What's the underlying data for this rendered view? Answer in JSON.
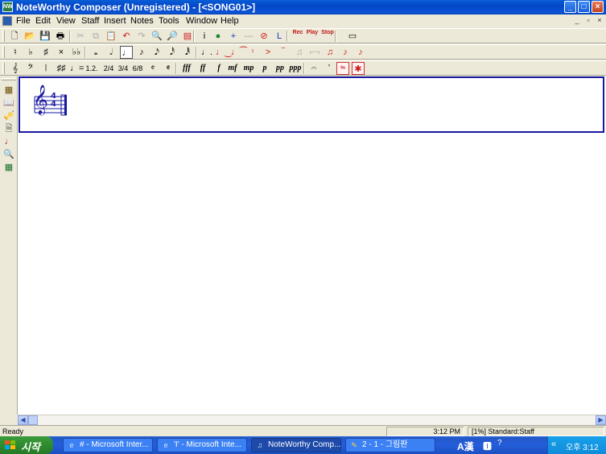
{
  "window": {
    "title": "NoteWorthy Composer (Unregistered) - [<SONG01>]",
    "icon": "noteworthy-app-icon",
    "app_icon_text": "NW",
    "controls": {
      "minimize": "_",
      "maximize": "□",
      "close": "×"
    }
  },
  "menubar": {
    "items": [
      "File",
      "Edit",
      "View",
      "Staff",
      "Insert",
      "Notes",
      "Tools",
      "Window",
      "Help"
    ],
    "mdi": {
      "minimize": "_",
      "restore": "▫",
      "close": "×"
    }
  },
  "toolbar_main": [
    {
      "icon": "new-file-icon",
      "glyph": "🗋"
    },
    {
      "icon": "open-folder-icon",
      "glyph": "📂"
    },
    {
      "icon": "save-icon",
      "glyph": "💾"
    },
    {
      "icon": "print-icon",
      "glyph": "🖶"
    },
    {
      "icon": "cut-icon",
      "glyph": "✂"
    },
    {
      "icon": "copy-icon",
      "glyph": "⧉"
    },
    {
      "icon": "paste-icon",
      "glyph": "📋"
    },
    {
      "icon": "undo-icon",
      "glyph": "↶"
    },
    {
      "icon": "redo-icon",
      "glyph": "↷"
    },
    {
      "icon": "zoom-in-icon",
      "glyph": "🔍"
    },
    {
      "icon": "zoom-out-icon",
      "glyph": "🔎"
    },
    {
      "icon": "staff-properties-icon",
      "glyph": "▤"
    },
    {
      "icon": "info-icon",
      "glyph": "i"
    },
    {
      "icon": "globe-icon",
      "glyph": "●"
    },
    {
      "icon": "add-staff-icon",
      "glyph": "+"
    },
    {
      "icon": "delete-staff-icon",
      "glyph": "—"
    },
    {
      "icon": "mute-icon",
      "glyph": "⊘"
    },
    {
      "icon": "lyrics-icon",
      "glyph": "L"
    },
    {
      "icon": "record-icon",
      "label": "Rec"
    },
    {
      "icon": "play-icon",
      "label": "Play"
    },
    {
      "icon": "stop-icon",
      "label": "Stop"
    },
    {
      "icon": "piano-keyboard-icon",
      "glyph": "▭"
    }
  ],
  "toolbar_notes": [
    {
      "icon": "natural-icon",
      "glyph": "♮"
    },
    {
      "icon": "flat-icon",
      "glyph": "♭"
    },
    {
      "icon": "sharp-icon",
      "glyph": "♯"
    },
    {
      "icon": "double-sharp-icon",
      "glyph": "×"
    },
    {
      "icon": "double-flat-icon",
      "glyph": "♭♭"
    },
    {
      "icon": "whole-note-icon",
      "glyph": "𝅝"
    },
    {
      "icon": "half-note-icon",
      "glyph": "𝅗𝅥"
    },
    {
      "icon": "quarter-note-icon",
      "glyph": "♩"
    },
    {
      "icon": "eighth-note-icon",
      "glyph": "♪"
    },
    {
      "icon": "sixteenth-note-icon",
      "glyph": "𝅘𝅥𝅯"
    },
    {
      "icon": "thirtysecond-note-icon",
      "glyph": "𝅘𝅥𝅰"
    },
    {
      "icon": "sixtyfourth-note-icon",
      "glyph": "𝅘𝅥𝅱"
    },
    {
      "icon": "dotted-note-icon",
      "glyph": "♩."
    },
    {
      "icon": "slur-icon",
      "glyph": "♩‿"
    },
    {
      "icon": "tie-icon",
      "glyph": "♩⁀"
    },
    {
      "icon": "staccato-icon",
      "glyph": "ᶦ"
    },
    {
      "icon": "accent-icon",
      "glyph": ">"
    },
    {
      "icon": "tenuto-icon",
      "glyph": "‾"
    },
    {
      "icon": "grace-note-icon",
      "glyph": "♫"
    },
    {
      "icon": "triplet-icon",
      "glyph": "⌐¬"
    },
    {
      "icon": "beam-icon",
      "glyph": "♫"
    },
    {
      "icon": "stem-up-icon",
      "glyph": "♪"
    },
    {
      "icon": "stem-down-icon",
      "glyph": "♪"
    }
  ],
  "toolbar_symbols": [
    {
      "icon": "treble-clef-icon",
      "glyph": "𝄞"
    },
    {
      "icon": "bass-clef-icon",
      "glyph": "𝄢"
    },
    {
      "icon": "double-barline-icon",
      "glyph": "𝄁"
    },
    {
      "icon": "key-signature-icon",
      "glyph": "♯♯"
    },
    {
      "icon": "tempo-icon",
      "glyph": "♩="
    },
    {
      "icon": "ending-icon",
      "glyph": "1.2."
    },
    {
      "icon": "time-sig-2-4-icon",
      "glyph": "2/4"
    },
    {
      "icon": "time-sig-3-4-icon",
      "glyph": "3/4"
    },
    {
      "icon": "time-sig-6-8-icon",
      "glyph": "6/8"
    },
    {
      "icon": "common-time-icon",
      "glyph": "𝄴"
    },
    {
      "icon": "cut-time-icon",
      "glyph": "𝄵"
    }
  ],
  "dynamics": [
    "fff",
    "ff",
    "f",
    "mf",
    "mp",
    "p",
    "pp",
    "ppp"
  ],
  "toolbar_extra": [
    {
      "icon": "fermata-icon",
      "glyph": "𝄐"
    },
    {
      "icon": "breath-mark-icon",
      "glyph": "ʼ"
    },
    {
      "icon": "pedal-down-icon",
      "glyph": "𝆮"
    },
    {
      "icon": "pedal-up-icon",
      "glyph": "✱"
    }
  ],
  "left_tools": [
    {
      "icon": "staff-view-icon",
      "glyph": "▦"
    },
    {
      "icon": "book-icon",
      "glyph": "📖"
    },
    {
      "icon": "instrument-icon",
      "glyph": "🎺"
    },
    {
      "icon": "page-setup-icon",
      "glyph": "🗎"
    },
    {
      "icon": "note-entry-icon",
      "glyph": "♩"
    },
    {
      "icon": "find-icon",
      "glyph": "🔍"
    },
    {
      "icon": "grid-icon",
      "glyph": "▦"
    }
  ],
  "staff": {
    "clef": "treble",
    "time_signature": "4/4"
  },
  "statusbar": {
    "text": "Ready",
    "time": "3:12 PM",
    "staff_info": "[1%] Standard:Staff"
  },
  "taskbar": {
    "start_label": "시작",
    "buttons": [
      {
        "label": "# - Microsoft Inter...",
        "icon": "ie-icon",
        "active": false
      },
      {
        "label": "'I' - Microsoft Inte...",
        "icon": "ie-icon",
        "active": false
      },
      {
        "label": "NoteWorthy Comp...",
        "icon": "noteworthy-icon",
        "active": true
      },
      {
        "label": "2 - 1 - 그림판",
        "icon": "paint-icon",
        "active": false
      }
    ],
    "language": "A漢",
    "tray_time": "오후 3:12"
  },
  "colors": {
    "titlebar": "#0346c5",
    "staff_frame": "#1818a0",
    "taskbar": "#245edb",
    "start_button": "#2e8b2e",
    "tray": "#0f8cdb"
  }
}
